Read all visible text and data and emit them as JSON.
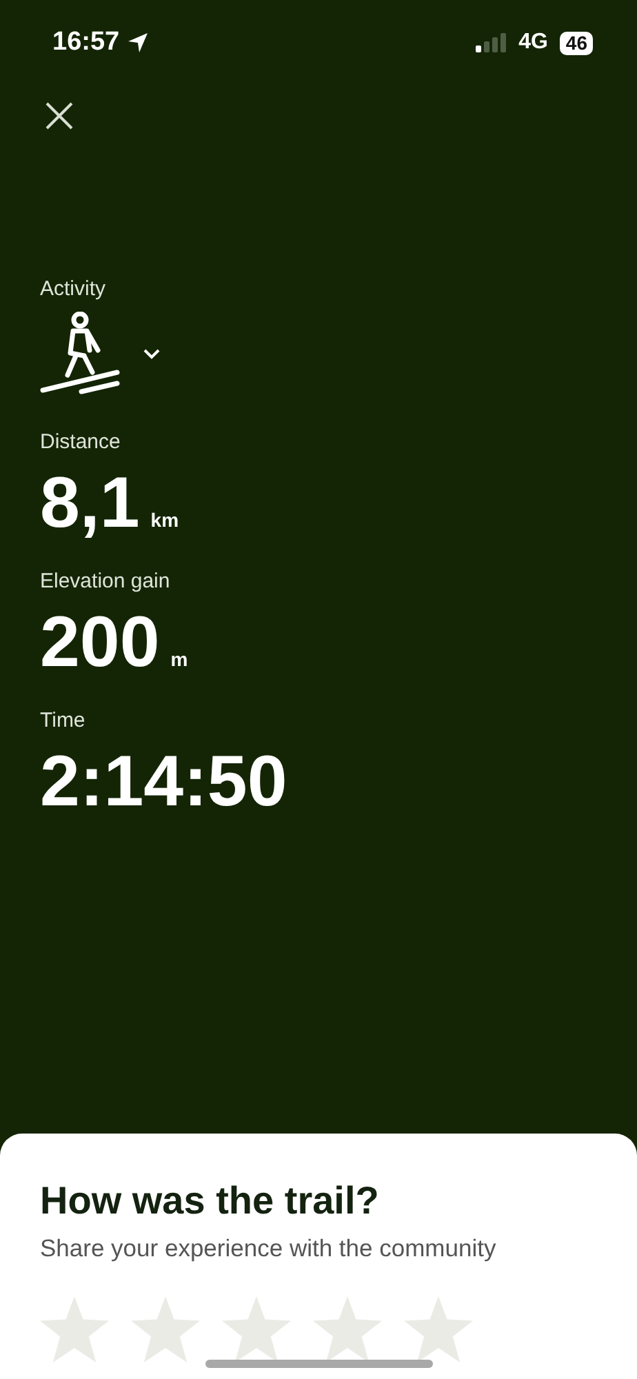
{
  "status_bar": {
    "time": "16:57",
    "network": "4G",
    "battery": "46"
  },
  "activity": {
    "label": "Activity"
  },
  "stats": [
    {
      "label": "Distance",
      "value": "8,1",
      "unit": "km"
    },
    {
      "label": "Elevation gain",
      "value": "200",
      "unit": "m"
    },
    {
      "label": "Time",
      "value": "2:14:50"
    }
  ],
  "rating_sheet": {
    "title": "How was the trail?",
    "subtitle": "Share your experience with the community",
    "stars": 0
  }
}
